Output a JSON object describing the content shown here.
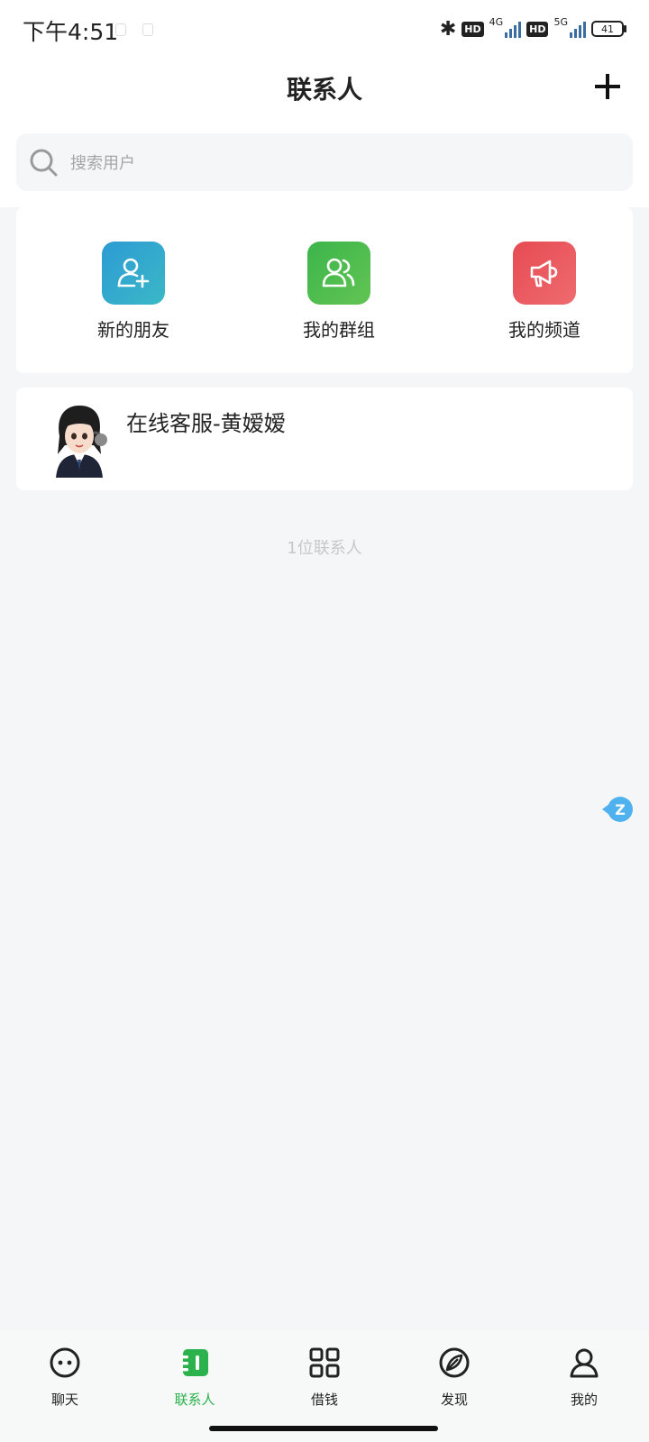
{
  "status_bar": {
    "time": "下午4:51",
    "network_1": "4G",
    "network_2": "5G",
    "hd_1": "HD",
    "hd_2": "HD",
    "battery": "41"
  },
  "header": {
    "title": "联系人",
    "add_icon": "plus-icon"
  },
  "search": {
    "placeholder": "搜索用户",
    "value": ""
  },
  "quick_actions": [
    {
      "label": "新的朋友",
      "icon": "add-friend-icon",
      "color": "#2d9bd4"
    },
    {
      "label": "我的群组",
      "icon": "group-icon",
      "color": "#3cb54a"
    },
    {
      "label": "我的频道",
      "icon": "megaphone-icon",
      "color": "#e64b52"
    }
  ],
  "contacts": [
    {
      "name": "在线客服-黄嫒嫒",
      "avatar": "customer-service-avatar"
    }
  ],
  "contact_count": "1位联系人",
  "floating_badge": "Z",
  "tabbar": {
    "items": [
      {
        "label": "聊天",
        "icon": "chat-icon"
      },
      {
        "label": "联系人",
        "icon": "contacts-icon",
        "active": true
      },
      {
        "label": "借钱",
        "icon": "grid-icon"
      },
      {
        "label": "发现",
        "icon": "compass-icon"
      },
      {
        "label": "我的",
        "icon": "profile-icon"
      }
    ],
    "active_color": "#2bb24c"
  }
}
